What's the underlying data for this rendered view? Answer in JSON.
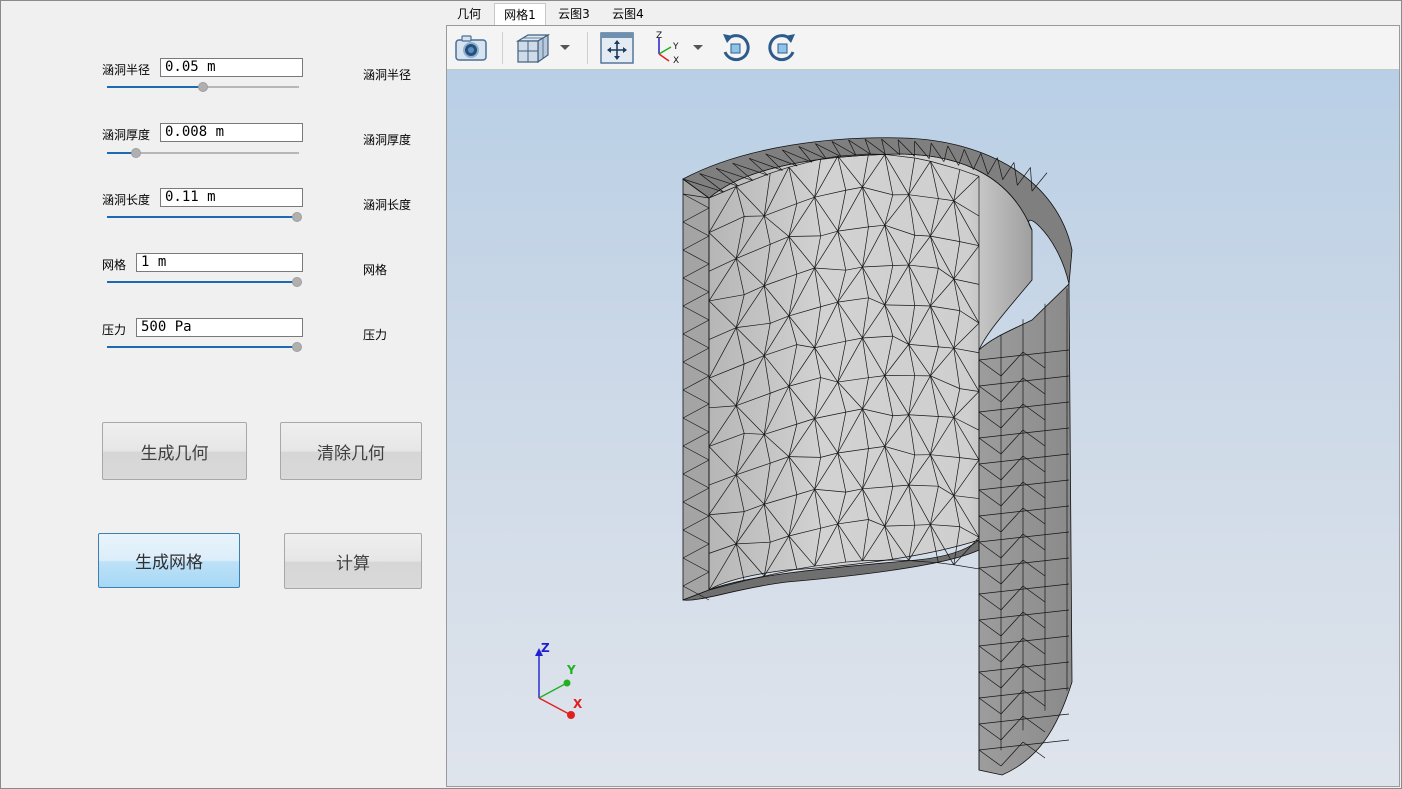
{
  "params": [
    {
      "label": "涵洞半径",
      "value": "0.05 m",
      "right_label": "涵洞半径",
      "slider": 0.5
    },
    {
      "label": "涵洞厚度",
      "value": "0.008 m",
      "right_label": "涵洞厚度",
      "slider": 0.15
    },
    {
      "label": "涵洞长度",
      "value": "0.11 m",
      "right_label": "涵洞长度",
      "slider": 1.0
    },
    {
      "label": "网格",
      "value": "1 m",
      "right_label": "网格",
      "slider": 1.0
    },
    {
      "label": "压力",
      "value": "500 Pa",
      "right_label": "压力",
      "slider": 1.0
    }
  ],
  "buttons": {
    "generate_geometry": "生成几何",
    "clear_geometry": "清除几何",
    "generate_mesh": "生成网格",
    "compute": "计算"
  },
  "tabs": [
    "几何",
    "网格1",
    "云图3",
    "云图4"
  ],
  "selected_tab": 1,
  "toolbar": {
    "icons": [
      "camera-icon",
      "cube-view-icon",
      "fit-view-icon",
      "axis-orientation-icon",
      "rotate-clockwise-icon",
      "rotate-counterclockwise-icon"
    ],
    "axis_icon_labels": {
      "z": "Z",
      "y": "Y",
      "x": "X"
    }
  },
  "triad": {
    "z": "Z",
    "y": "Y",
    "x": "X"
  },
  "colors": {
    "accent": "#1e6ab0",
    "triad_x": "#e02020",
    "triad_y": "#22b022",
    "triad_z": "#2020d0",
    "mesh_face": "#c8c8c8",
    "mesh_edge": "#202020"
  }
}
